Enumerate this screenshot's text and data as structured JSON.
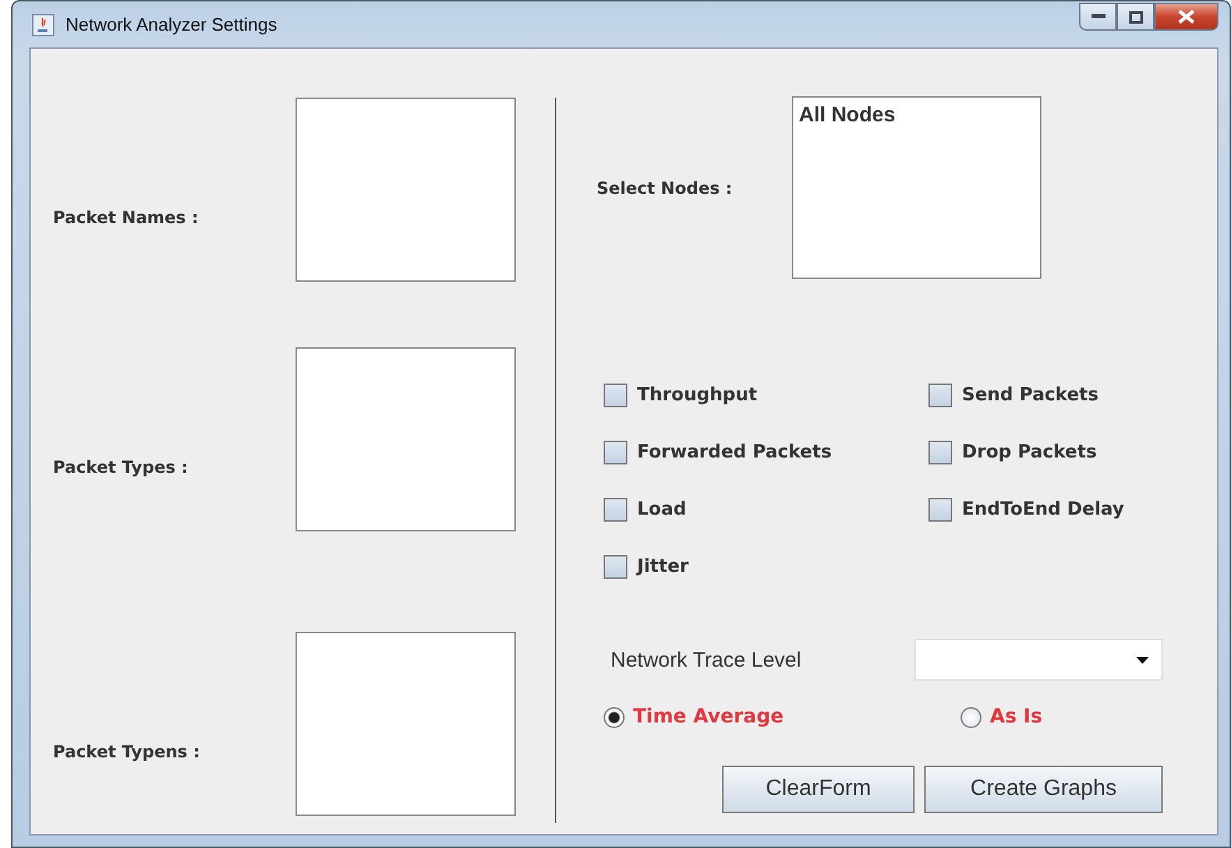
{
  "window": {
    "title": "Network Analyzer Settings"
  },
  "left_fields": [
    {
      "label": "Packet Names :"
    },
    {
      "label": "Packet Types :"
    },
    {
      "label": "Packet Typens :"
    }
  ],
  "nodes": {
    "label": "Select Nodes :",
    "items": [
      {
        "text": "All Nodes",
        "selected": false
      }
    ]
  },
  "checkboxes": [
    {
      "label": "Throughput",
      "checked": false
    },
    {
      "label": "Send Packets",
      "checked": false
    },
    {
      "label": "Forwarded Packets",
      "checked": false
    },
    {
      "label": "Drop Packets",
      "checked": false
    },
    {
      "label": "Load",
      "checked": false
    },
    {
      "label": "EndToEnd Delay",
      "checked": false
    },
    {
      "label": "Jitter",
      "checked": false
    }
  ],
  "trace_level": {
    "label": "Network Trace Level"
  },
  "radios": [
    {
      "label": "Time Average",
      "selected": true
    },
    {
      "label": "As Is",
      "selected": false
    }
  ],
  "buttons": [
    "ClearForm",
    "Create Graphs"
  ]
}
